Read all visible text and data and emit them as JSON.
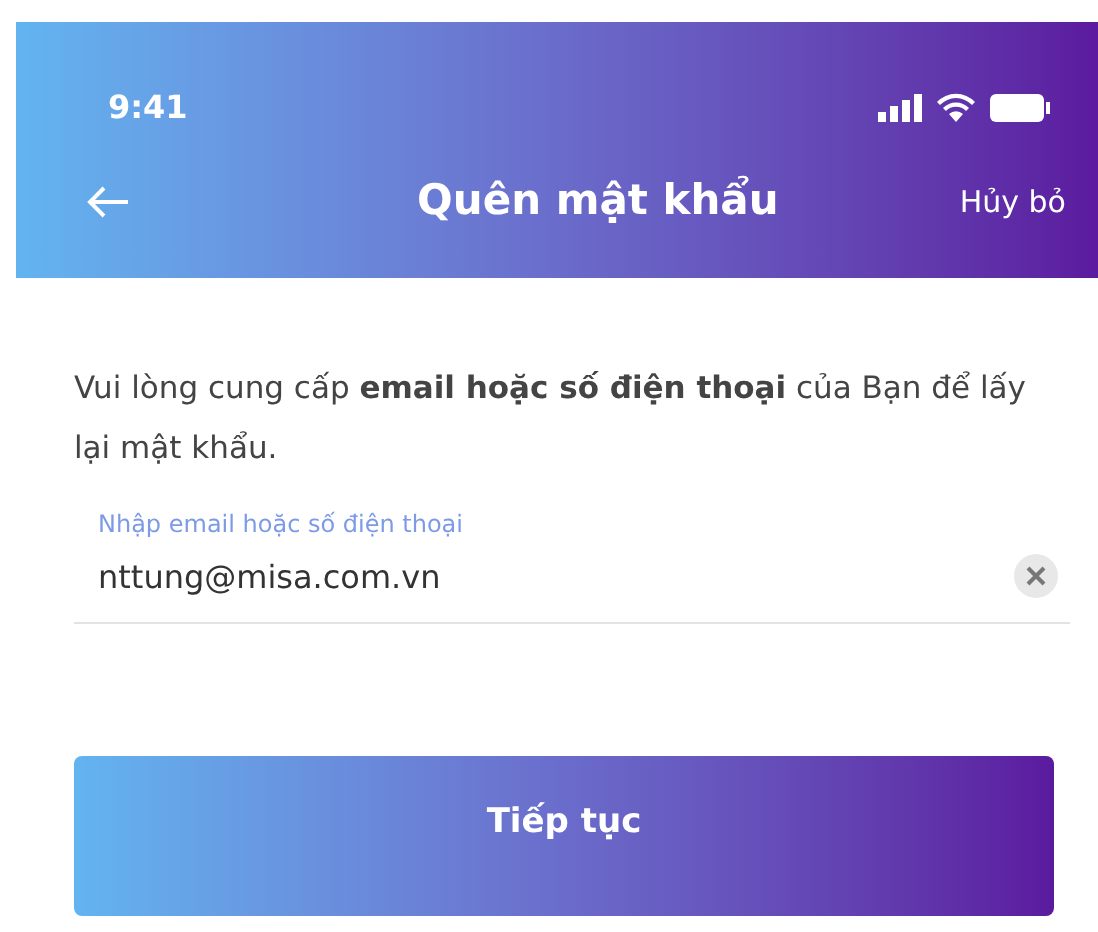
{
  "status_bar": {
    "time": "9:41"
  },
  "nav": {
    "title": "Quên mật khẩu",
    "action": "Hủy bỏ"
  },
  "description": "Vui lòng cung cấp **email hoặc số điện thoại** của Bạn để lấy lại mật khẩu.",
  "field": {
    "label": "Nhập email hoặc số điện thoại",
    "value": "nttung@misa.com.vn"
  },
  "buttons": [
    "Tiếp tục"
  ]
}
